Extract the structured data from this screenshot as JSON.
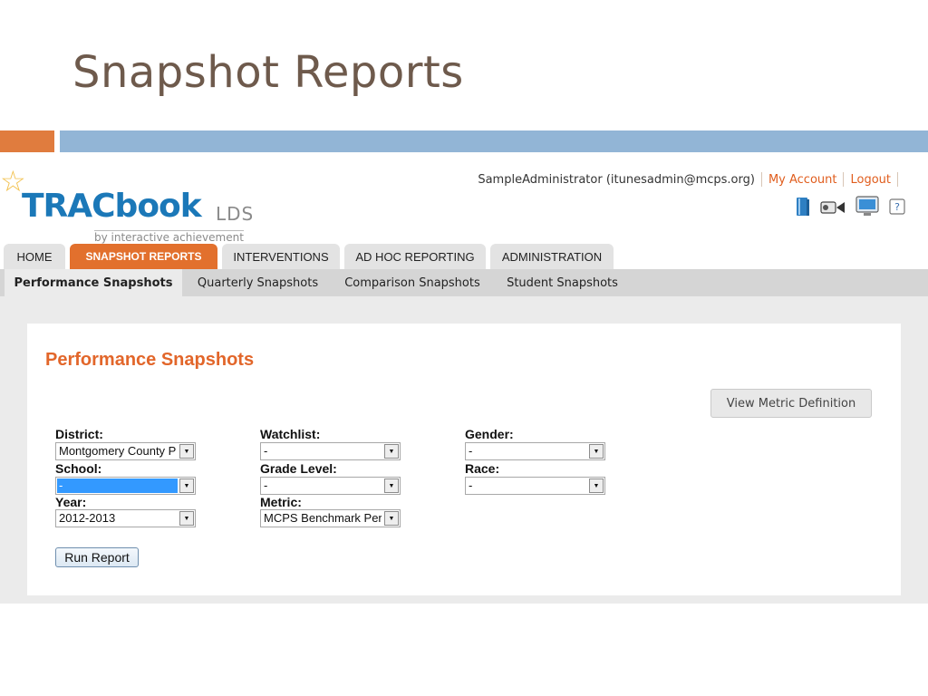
{
  "slide": {
    "title": "Snapshot Reports"
  },
  "header": {
    "logo_main": "TRACbook",
    "logo_suffix": "LDS",
    "logo_tagline": "by interactive achievement",
    "user_text": "SampleAdministrator (itunesadmin@mcps.org)",
    "my_account": "My Account",
    "logout": "Logout",
    "icons": [
      "book-icon",
      "video-icon",
      "monitor-icon",
      "help-icon"
    ]
  },
  "main_tabs": [
    {
      "label": "HOME",
      "active": false
    },
    {
      "label": "SNAPSHOT REPORTS",
      "active": true
    },
    {
      "label": "INTERVENTIONS",
      "active": false
    },
    {
      "label": "AD HOC REPORTING",
      "active": false
    },
    {
      "label": "ADMINISTRATION",
      "active": false
    }
  ],
  "sub_tabs": [
    {
      "label": "Performance Snapshots",
      "active": true
    },
    {
      "label": "Quarterly Snapshots",
      "active": false
    },
    {
      "label": "Comparison Snapshots",
      "active": false
    },
    {
      "label": "Student Snapshots",
      "active": false
    }
  ],
  "panel": {
    "title": "Performance Snapshots",
    "metric_button": "View Metric Definition",
    "run_button": "Run Report",
    "filters": {
      "district": {
        "label": "District:",
        "value": "Montgomery County Public"
      },
      "school": {
        "label": "School:",
        "value": "-"
      },
      "year": {
        "label": "Year:",
        "value": "2012-2013"
      },
      "watchlist": {
        "label": "Watchlist:",
        "value": "-"
      },
      "grade_level": {
        "label": "Grade Level:",
        "value": "-"
      },
      "metric": {
        "label": "Metric:",
        "value": "MCPS Benchmark Performance"
      },
      "gender": {
        "label": "Gender:",
        "value": "-"
      },
      "race": {
        "label": "Race:",
        "value": "-"
      }
    }
  },
  "colors": {
    "accent_orange": "#e2702d",
    "band_blue": "#92b5d6",
    "title_brown": "#6e5a4c",
    "logo_blue": "#1b78b8"
  }
}
